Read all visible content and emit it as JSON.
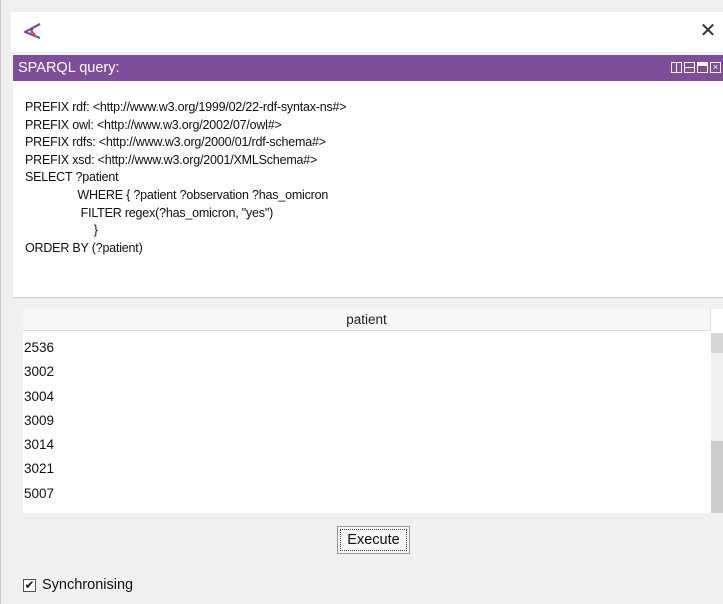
{
  "window": {
    "close_glyph": "✕"
  },
  "panel": {
    "title": "SPARQL query:"
  },
  "query": {
    "text": "PREFIX rdf: <http://www.w3.org/1999/02/22-rdf-syntax-ns#>\nPREFIX owl: <http://www.w3.org/2002/07/owl#>\nPREFIX rdfs: <http://www.w3.org/2000/01/rdf-schema#>\nPREFIX xsd: <http://www.w3.org/2001/XMLSchema#>\nSELECT ?patient\n                WHERE { ?patient ?observation ?has_omicron\n                 FILTER regex(?has_omicron, \"yes\")\n                     }\nORDER BY (?patient)"
  },
  "results": {
    "column_header": "patient",
    "rows": [
      "2536",
      "3002",
      "3004",
      "3009",
      "3014",
      "3021",
      "5007"
    ]
  },
  "actions": {
    "execute_label": "Execute"
  },
  "sync": {
    "label": "Synchronising",
    "checked": true,
    "check_glyph": "✔"
  },
  "colors": {
    "header_bar": "#7e4e9b"
  }
}
